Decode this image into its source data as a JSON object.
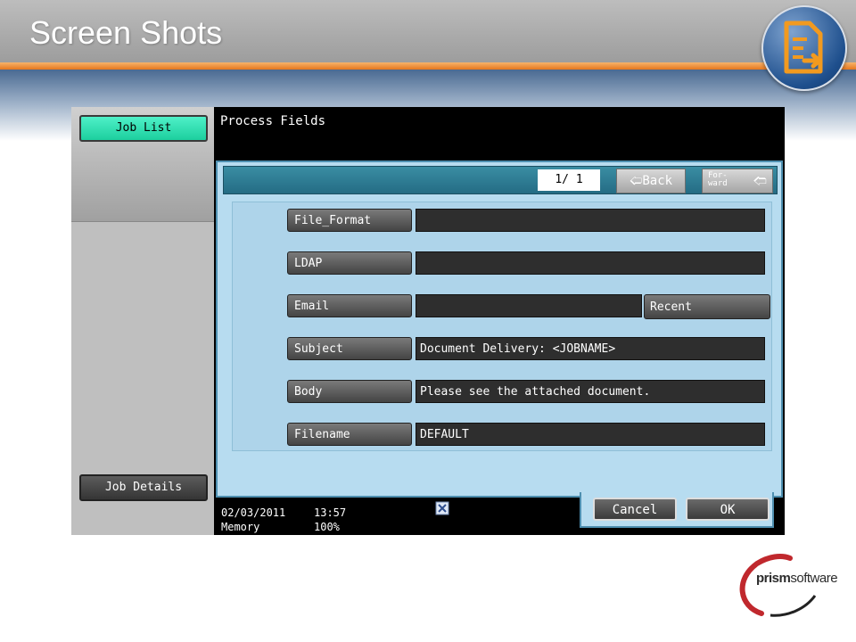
{
  "slide": {
    "title": "Screen Shots"
  },
  "brand": {
    "logo_prefix": "prism",
    "logo_suffix": "software"
  },
  "left_panel": {
    "job_list_label": "Job List",
    "job_details_label": "Job Details"
  },
  "main": {
    "title": "Process Fields",
    "pager": {
      "indicator": "1/  1",
      "back_label": "Back",
      "forward_label": "For-ward"
    },
    "fields": [
      {
        "label": "File_Format",
        "value": ""
      },
      {
        "label": "LDAP",
        "value": ""
      },
      {
        "label": "Email",
        "value": ""
      },
      {
        "label": "Subject",
        "value": "Document Delivery: <JOBNAME>"
      },
      {
        "label": "Body",
        "value": "Please see the attached document."
      },
      {
        "label": "Filename",
        "value": "DEFAULT"
      }
    ],
    "recent_label": "Recent"
  },
  "status": {
    "date": "02/03/2011",
    "time": "13:57",
    "memory_label": "Memory",
    "memory_value": "100%"
  },
  "actions": {
    "cancel_label": "Cancel",
    "ok_label": "OK"
  },
  "colors": {
    "accent_teal": "#1ccf9e",
    "header_orange": "#e5771e",
    "panel_blue": "#b7dcf0"
  }
}
